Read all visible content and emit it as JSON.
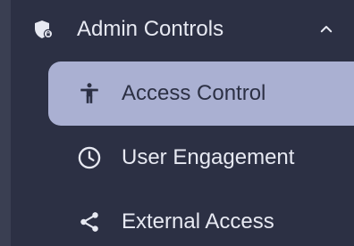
{
  "sidebar": {
    "section": {
      "label": "Admin Controls",
      "icon": "shield-lock-icon",
      "expanded": true,
      "toggle_icon": "chevron-up-icon"
    },
    "items": [
      {
        "label": "Access Control",
        "icon": "accessibility-person-icon",
        "active": true
      },
      {
        "label": "User Engagement",
        "icon": "clock-icon",
        "active": false
      },
      {
        "label": "External Access",
        "icon": "share-icon",
        "active": false
      }
    ]
  },
  "colors": {
    "background": "#2c3044",
    "active_item": "#aab0d2",
    "text": "#e7e9f2",
    "active_text": "#2c3044"
  }
}
